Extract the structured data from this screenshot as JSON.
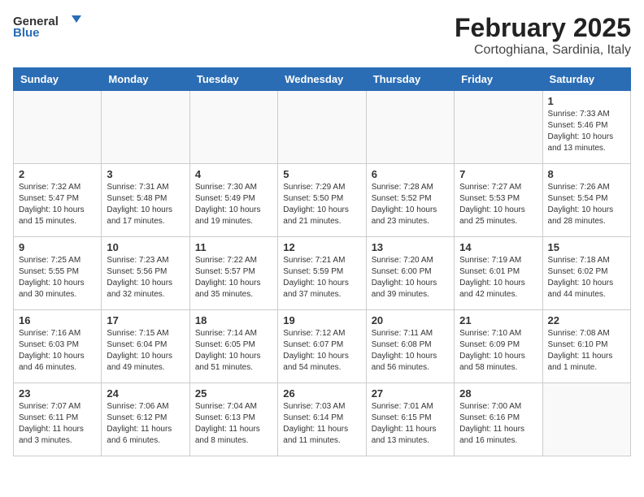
{
  "header": {
    "logo_line1": "General",
    "logo_line2": "Blue",
    "title": "February 2025",
    "subtitle": "Cortoghiana, Sardinia, Italy"
  },
  "weekdays": [
    "Sunday",
    "Monday",
    "Tuesday",
    "Wednesday",
    "Thursday",
    "Friday",
    "Saturday"
  ],
  "weeks": [
    [
      {
        "day": "",
        "info": ""
      },
      {
        "day": "",
        "info": ""
      },
      {
        "day": "",
        "info": ""
      },
      {
        "day": "",
        "info": ""
      },
      {
        "day": "",
        "info": ""
      },
      {
        "day": "",
        "info": ""
      },
      {
        "day": "1",
        "info": "Sunrise: 7:33 AM\nSunset: 5:46 PM\nDaylight: 10 hours and 13 minutes."
      }
    ],
    [
      {
        "day": "2",
        "info": "Sunrise: 7:32 AM\nSunset: 5:47 PM\nDaylight: 10 hours and 15 minutes."
      },
      {
        "day": "3",
        "info": "Sunrise: 7:31 AM\nSunset: 5:48 PM\nDaylight: 10 hours and 17 minutes."
      },
      {
        "day": "4",
        "info": "Sunrise: 7:30 AM\nSunset: 5:49 PM\nDaylight: 10 hours and 19 minutes."
      },
      {
        "day": "5",
        "info": "Sunrise: 7:29 AM\nSunset: 5:50 PM\nDaylight: 10 hours and 21 minutes."
      },
      {
        "day": "6",
        "info": "Sunrise: 7:28 AM\nSunset: 5:52 PM\nDaylight: 10 hours and 23 minutes."
      },
      {
        "day": "7",
        "info": "Sunrise: 7:27 AM\nSunset: 5:53 PM\nDaylight: 10 hours and 25 minutes."
      },
      {
        "day": "8",
        "info": "Sunrise: 7:26 AM\nSunset: 5:54 PM\nDaylight: 10 hours and 28 minutes."
      }
    ],
    [
      {
        "day": "9",
        "info": "Sunrise: 7:25 AM\nSunset: 5:55 PM\nDaylight: 10 hours and 30 minutes."
      },
      {
        "day": "10",
        "info": "Sunrise: 7:23 AM\nSunset: 5:56 PM\nDaylight: 10 hours and 32 minutes."
      },
      {
        "day": "11",
        "info": "Sunrise: 7:22 AM\nSunset: 5:57 PM\nDaylight: 10 hours and 35 minutes."
      },
      {
        "day": "12",
        "info": "Sunrise: 7:21 AM\nSunset: 5:59 PM\nDaylight: 10 hours and 37 minutes."
      },
      {
        "day": "13",
        "info": "Sunrise: 7:20 AM\nSunset: 6:00 PM\nDaylight: 10 hours and 39 minutes."
      },
      {
        "day": "14",
        "info": "Sunrise: 7:19 AM\nSunset: 6:01 PM\nDaylight: 10 hours and 42 minutes."
      },
      {
        "day": "15",
        "info": "Sunrise: 7:18 AM\nSunset: 6:02 PM\nDaylight: 10 hours and 44 minutes."
      }
    ],
    [
      {
        "day": "16",
        "info": "Sunrise: 7:16 AM\nSunset: 6:03 PM\nDaylight: 10 hours and 46 minutes."
      },
      {
        "day": "17",
        "info": "Sunrise: 7:15 AM\nSunset: 6:04 PM\nDaylight: 10 hours and 49 minutes."
      },
      {
        "day": "18",
        "info": "Sunrise: 7:14 AM\nSunset: 6:05 PM\nDaylight: 10 hours and 51 minutes."
      },
      {
        "day": "19",
        "info": "Sunrise: 7:12 AM\nSunset: 6:07 PM\nDaylight: 10 hours and 54 minutes."
      },
      {
        "day": "20",
        "info": "Sunrise: 7:11 AM\nSunset: 6:08 PM\nDaylight: 10 hours and 56 minutes."
      },
      {
        "day": "21",
        "info": "Sunrise: 7:10 AM\nSunset: 6:09 PM\nDaylight: 10 hours and 58 minutes."
      },
      {
        "day": "22",
        "info": "Sunrise: 7:08 AM\nSunset: 6:10 PM\nDaylight: 11 hours and 1 minute."
      }
    ],
    [
      {
        "day": "23",
        "info": "Sunrise: 7:07 AM\nSunset: 6:11 PM\nDaylight: 11 hours and 3 minutes."
      },
      {
        "day": "24",
        "info": "Sunrise: 7:06 AM\nSunset: 6:12 PM\nDaylight: 11 hours and 6 minutes."
      },
      {
        "day": "25",
        "info": "Sunrise: 7:04 AM\nSunset: 6:13 PM\nDaylight: 11 hours and 8 minutes."
      },
      {
        "day": "26",
        "info": "Sunrise: 7:03 AM\nSunset: 6:14 PM\nDaylight: 11 hours and 11 minutes."
      },
      {
        "day": "27",
        "info": "Sunrise: 7:01 AM\nSunset: 6:15 PM\nDaylight: 11 hours and 13 minutes."
      },
      {
        "day": "28",
        "info": "Sunrise: 7:00 AM\nSunset: 6:16 PM\nDaylight: 11 hours and 16 minutes."
      },
      {
        "day": "",
        "info": ""
      }
    ]
  ]
}
